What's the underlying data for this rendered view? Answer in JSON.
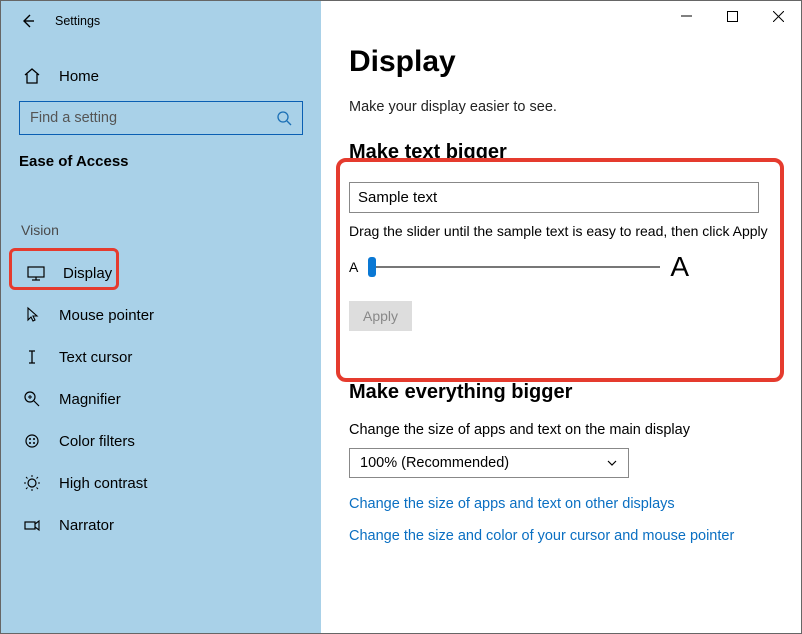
{
  "titlebar": {
    "title": "Settings"
  },
  "sidebar": {
    "home_label": "Home",
    "search_placeholder": "Find a setting",
    "category": "Ease of Access",
    "section": "Vision",
    "items": [
      {
        "label": "Display"
      },
      {
        "label": "Mouse pointer"
      },
      {
        "label": "Text cursor"
      },
      {
        "label": "Magnifier"
      },
      {
        "label": "Color filters"
      },
      {
        "label": "High contrast"
      },
      {
        "label": "Narrator"
      }
    ]
  },
  "main": {
    "title": "Display",
    "subtitle": "Make your display easier to see.",
    "text_bigger": {
      "heading": "Make text bigger",
      "sample": "Sample text",
      "hint": "Drag the slider until the sample text is easy to read, then click Apply",
      "small_a": "A",
      "big_a": "A",
      "apply": "Apply"
    },
    "everything_bigger": {
      "heading": "Make everything bigger",
      "desc": "Change the size of apps and text on the main display",
      "dropdown_value": "100% (Recommended)",
      "link1": "Change the size of apps and text on other displays",
      "link2": "Change the size and color of your cursor and mouse pointer"
    }
  }
}
